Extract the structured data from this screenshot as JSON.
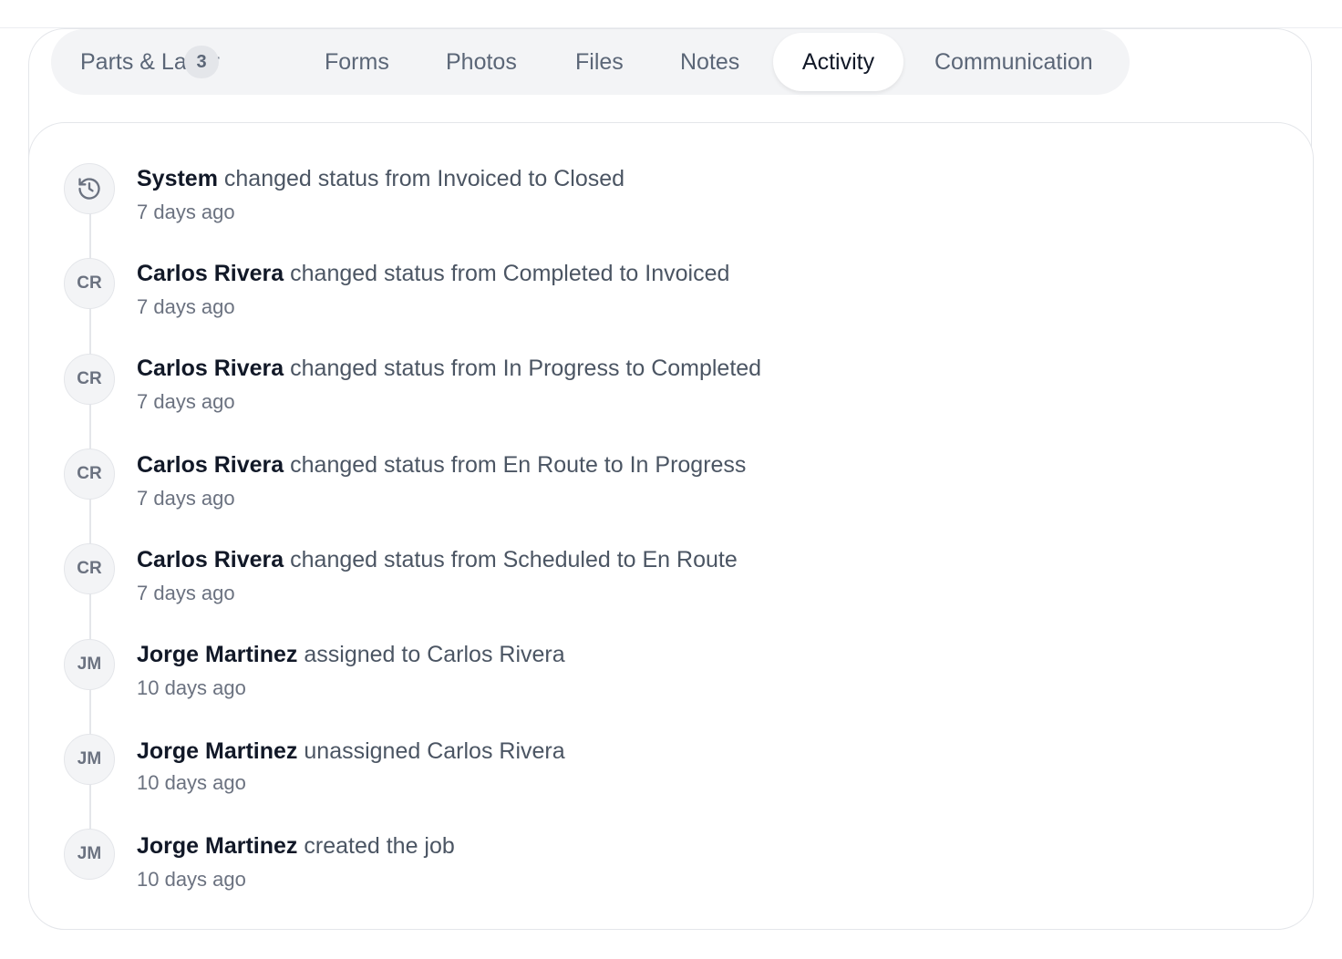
{
  "tabs": [
    {
      "label": "Parts & Labor",
      "count": "3"
    },
    {
      "label": "Forms"
    },
    {
      "label": "Photos"
    },
    {
      "label": "Files"
    },
    {
      "label": "Notes"
    },
    {
      "label": "Activity",
      "active": true
    },
    {
      "label": "Communication"
    }
  ],
  "activity": [
    {
      "avatar": "history-icon",
      "actor": "System",
      "action": "changed status from Invoiced to Closed",
      "time": "7 days ago"
    },
    {
      "avatar": "CR",
      "actor": "Carlos Rivera",
      "action": "changed status from Completed to Invoiced",
      "time": "7 days ago"
    },
    {
      "avatar": "CR",
      "actor": "Carlos Rivera",
      "action": "changed status from In Progress to Completed",
      "time": "7 days ago"
    },
    {
      "avatar": "CR",
      "actor": "Carlos Rivera",
      "action": "changed status from En Route to In Progress",
      "time": "7 days ago"
    },
    {
      "avatar": "CR",
      "actor": "Carlos Rivera",
      "action": "changed status from Scheduled to En Route",
      "time": "7 days ago"
    },
    {
      "avatar": "JM",
      "actor": "Jorge Martinez",
      "action": "assigned to Carlos Rivera",
      "time": "10 days ago"
    },
    {
      "avatar": "JM",
      "actor": "Jorge Martinez",
      "action": "unassigned Carlos Rivera",
      "time": "10 days ago"
    },
    {
      "avatar": "JM",
      "actor": "Jorge Martinez",
      "action": "created the job",
      "time": "10 days ago"
    }
  ]
}
